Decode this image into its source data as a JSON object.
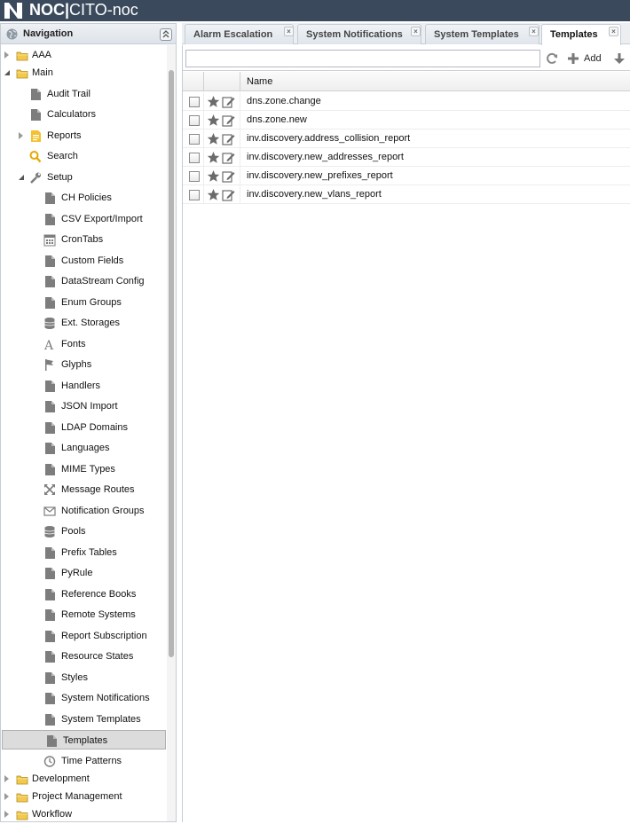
{
  "header": {
    "logo_icon": "noc-logo-icon",
    "title_bold": "NOC|",
    "title_rest": "CITO-noc"
  },
  "nav": {
    "title": "Navigation",
    "items": [
      {
        "label": "AAA",
        "icon": "folder-icon",
        "expander": "closed"
      },
      {
        "label": "Main",
        "icon": "folder-icon",
        "expander": "open"
      },
      {
        "label": "Audit Trail",
        "icon": "document-icon"
      },
      {
        "label": "Calculators",
        "icon": "document-icon"
      },
      {
        "label": "Reports",
        "icon": "report-icon",
        "expander": "closed"
      },
      {
        "label": "Search",
        "icon": "search-icon"
      },
      {
        "label": "Setup",
        "icon": "wrench-icon",
        "expander": "open"
      },
      {
        "label": "CH Policies",
        "icon": "document-icon"
      },
      {
        "label": "CSV Export/Import",
        "icon": "document-icon"
      },
      {
        "label": "CronTabs",
        "icon": "calendar-icon"
      },
      {
        "label": "Custom Fields",
        "icon": "document-icon"
      },
      {
        "label": "DataStream Config",
        "icon": "document-icon"
      },
      {
        "label": "Enum Groups",
        "icon": "document-icon"
      },
      {
        "label": "Ext. Storages",
        "icon": "database-icon"
      },
      {
        "label": "Fonts",
        "icon": "font-icon"
      },
      {
        "label": "Glyphs",
        "icon": "flag-icon"
      },
      {
        "label": "Handlers",
        "icon": "document-icon"
      },
      {
        "label": "JSON Import",
        "icon": "document-icon"
      },
      {
        "label": "LDAP Domains",
        "icon": "document-icon"
      },
      {
        "label": "Languages",
        "icon": "document-icon"
      },
      {
        "label": "MIME Types",
        "icon": "document-icon"
      },
      {
        "label": "Message Routes",
        "icon": "arrows-icon"
      },
      {
        "label": "Notification Groups",
        "icon": "envelope-icon"
      },
      {
        "label": "Pools",
        "icon": "database-icon"
      },
      {
        "label": "Prefix Tables",
        "icon": "document-icon"
      },
      {
        "label": "PyRule",
        "icon": "document-icon"
      },
      {
        "label": "Reference Books",
        "icon": "document-icon"
      },
      {
        "label": "Remote Systems",
        "icon": "document-icon"
      },
      {
        "label": "Report Subscription",
        "icon": "document-icon"
      },
      {
        "label": "Resource States",
        "icon": "document-icon"
      },
      {
        "label": "Styles",
        "icon": "document-icon"
      },
      {
        "label": "System Notifications",
        "icon": "document-icon"
      },
      {
        "label": "System Templates",
        "icon": "document-icon"
      },
      {
        "label": "Templates",
        "icon": "document-icon",
        "selected": true
      },
      {
        "label": "Time Patterns",
        "icon": "clock-icon"
      },
      {
        "label": "Development",
        "icon": "folder-icon",
        "expander": "closed"
      },
      {
        "label": "Project Management",
        "icon": "folder-icon",
        "expander": "closed"
      },
      {
        "label": "Workflow",
        "icon": "folder-icon",
        "expander": "closed"
      }
    ]
  },
  "tabs": [
    {
      "label": "Alarm Escalation",
      "active": false
    },
    {
      "label": "System Notifications",
      "active": false
    },
    {
      "label": "System Templates",
      "active": false
    },
    {
      "label": "Templates",
      "active": true
    }
  ],
  "toolbar": {
    "search_value": "",
    "add_label": "Add"
  },
  "grid": {
    "column_name": "Name",
    "rows": [
      "dns.zone.change",
      "dns.zone.new",
      "inv.discovery.address_collision_report",
      "inv.discovery.new_addresses_report",
      "inv.discovery.new_prefixes_report",
      "inv.discovery.new_vlans_report"
    ]
  },
  "colors": {
    "header_bg": "#3a4a5c",
    "folder": "#f2c94c",
    "report": "#f2c230"
  }
}
